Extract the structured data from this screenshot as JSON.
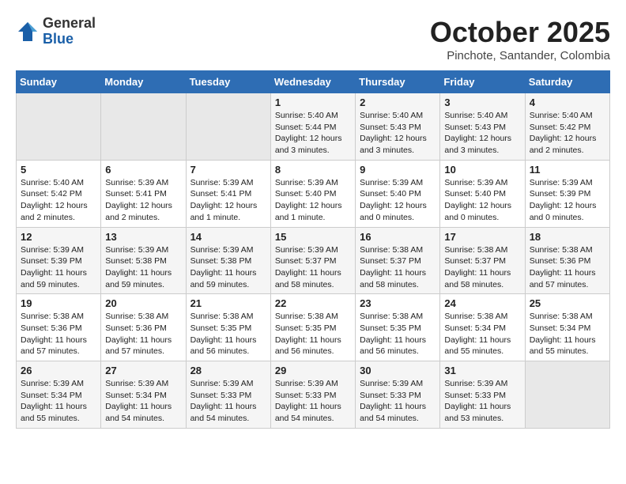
{
  "header": {
    "logo_general": "General",
    "logo_blue": "Blue",
    "month_title": "October 2025",
    "location": "Pinchote, Santander, Colombia"
  },
  "days_of_week": [
    "Sunday",
    "Monday",
    "Tuesday",
    "Wednesday",
    "Thursday",
    "Friday",
    "Saturday"
  ],
  "weeks": [
    [
      {
        "day": "",
        "info": ""
      },
      {
        "day": "",
        "info": ""
      },
      {
        "day": "",
        "info": ""
      },
      {
        "day": "1",
        "info": "Sunrise: 5:40 AM\nSunset: 5:44 PM\nDaylight: 12 hours\nand 3 minutes."
      },
      {
        "day": "2",
        "info": "Sunrise: 5:40 AM\nSunset: 5:43 PM\nDaylight: 12 hours\nand 3 minutes."
      },
      {
        "day": "3",
        "info": "Sunrise: 5:40 AM\nSunset: 5:43 PM\nDaylight: 12 hours\nand 3 minutes."
      },
      {
        "day": "4",
        "info": "Sunrise: 5:40 AM\nSunset: 5:42 PM\nDaylight: 12 hours\nand 2 minutes."
      }
    ],
    [
      {
        "day": "5",
        "info": "Sunrise: 5:40 AM\nSunset: 5:42 PM\nDaylight: 12 hours\nand 2 minutes."
      },
      {
        "day": "6",
        "info": "Sunrise: 5:39 AM\nSunset: 5:41 PM\nDaylight: 12 hours\nand 2 minutes."
      },
      {
        "day": "7",
        "info": "Sunrise: 5:39 AM\nSunset: 5:41 PM\nDaylight: 12 hours\nand 1 minute."
      },
      {
        "day": "8",
        "info": "Sunrise: 5:39 AM\nSunset: 5:40 PM\nDaylight: 12 hours\nand 1 minute."
      },
      {
        "day": "9",
        "info": "Sunrise: 5:39 AM\nSunset: 5:40 PM\nDaylight: 12 hours\nand 0 minutes."
      },
      {
        "day": "10",
        "info": "Sunrise: 5:39 AM\nSunset: 5:40 PM\nDaylight: 12 hours\nand 0 minutes."
      },
      {
        "day": "11",
        "info": "Sunrise: 5:39 AM\nSunset: 5:39 PM\nDaylight: 12 hours\nand 0 minutes."
      }
    ],
    [
      {
        "day": "12",
        "info": "Sunrise: 5:39 AM\nSunset: 5:39 PM\nDaylight: 11 hours\nand 59 minutes."
      },
      {
        "day": "13",
        "info": "Sunrise: 5:39 AM\nSunset: 5:38 PM\nDaylight: 11 hours\nand 59 minutes."
      },
      {
        "day": "14",
        "info": "Sunrise: 5:39 AM\nSunset: 5:38 PM\nDaylight: 11 hours\nand 59 minutes."
      },
      {
        "day": "15",
        "info": "Sunrise: 5:39 AM\nSunset: 5:37 PM\nDaylight: 11 hours\nand 58 minutes."
      },
      {
        "day": "16",
        "info": "Sunrise: 5:38 AM\nSunset: 5:37 PM\nDaylight: 11 hours\nand 58 minutes."
      },
      {
        "day": "17",
        "info": "Sunrise: 5:38 AM\nSunset: 5:37 PM\nDaylight: 11 hours\nand 58 minutes."
      },
      {
        "day": "18",
        "info": "Sunrise: 5:38 AM\nSunset: 5:36 PM\nDaylight: 11 hours\nand 57 minutes."
      }
    ],
    [
      {
        "day": "19",
        "info": "Sunrise: 5:38 AM\nSunset: 5:36 PM\nDaylight: 11 hours\nand 57 minutes."
      },
      {
        "day": "20",
        "info": "Sunrise: 5:38 AM\nSunset: 5:36 PM\nDaylight: 11 hours\nand 57 minutes."
      },
      {
        "day": "21",
        "info": "Sunrise: 5:38 AM\nSunset: 5:35 PM\nDaylight: 11 hours\nand 56 minutes."
      },
      {
        "day": "22",
        "info": "Sunrise: 5:38 AM\nSunset: 5:35 PM\nDaylight: 11 hours\nand 56 minutes."
      },
      {
        "day": "23",
        "info": "Sunrise: 5:38 AM\nSunset: 5:35 PM\nDaylight: 11 hours\nand 56 minutes."
      },
      {
        "day": "24",
        "info": "Sunrise: 5:38 AM\nSunset: 5:34 PM\nDaylight: 11 hours\nand 55 minutes."
      },
      {
        "day": "25",
        "info": "Sunrise: 5:38 AM\nSunset: 5:34 PM\nDaylight: 11 hours\nand 55 minutes."
      }
    ],
    [
      {
        "day": "26",
        "info": "Sunrise: 5:39 AM\nSunset: 5:34 PM\nDaylight: 11 hours\nand 55 minutes."
      },
      {
        "day": "27",
        "info": "Sunrise: 5:39 AM\nSunset: 5:34 PM\nDaylight: 11 hours\nand 54 minutes."
      },
      {
        "day": "28",
        "info": "Sunrise: 5:39 AM\nSunset: 5:33 PM\nDaylight: 11 hours\nand 54 minutes."
      },
      {
        "day": "29",
        "info": "Sunrise: 5:39 AM\nSunset: 5:33 PM\nDaylight: 11 hours\nand 54 minutes."
      },
      {
        "day": "30",
        "info": "Sunrise: 5:39 AM\nSunset: 5:33 PM\nDaylight: 11 hours\nand 54 minutes."
      },
      {
        "day": "31",
        "info": "Sunrise: 5:39 AM\nSunset: 5:33 PM\nDaylight: 11 hours\nand 53 minutes."
      },
      {
        "day": "",
        "info": ""
      }
    ]
  ]
}
